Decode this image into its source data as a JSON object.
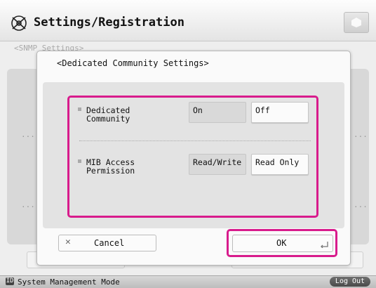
{
  "header": {
    "title": "Settings/Registration"
  },
  "background": {
    "breadcrumb": "<SNMP Settings>",
    "cancel_label": "Cancel",
    "ok_label": "OK",
    "dots": "..."
  },
  "dialog": {
    "title": "<Dedicated Community Settings>",
    "rows": [
      {
        "label": "Dedicated\nCommunity",
        "options": [
          "On",
          "Off"
        ],
        "selected": "On"
      },
      {
        "label": "MIB Access\nPermission",
        "options": [
          "Read/Write",
          "Read Only"
        ],
        "selected": "Read/Write"
      }
    ],
    "cancel_label": "Cancel",
    "ok_label": "OK"
  },
  "statusbar": {
    "mode_icon": "ID",
    "mode_text": "System Management Mode",
    "logout_label": "Log Out"
  },
  "colors": {
    "highlight": "#d81b8c"
  }
}
